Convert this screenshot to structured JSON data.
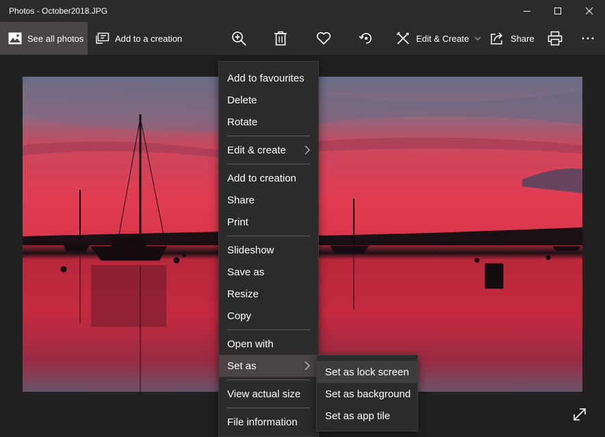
{
  "window": {
    "title": "Photos - October2018.JPG"
  },
  "toolbar": {
    "see_all_photos": "See all photos",
    "add_to_creation": "Add to a creation",
    "edit_create": "Edit & Create",
    "share": "Share",
    "icons": [
      "zoom-in-icon",
      "delete-icon",
      "heart-icon",
      "rotate-icon",
      "edit-create-icon",
      "share-icon",
      "print-icon",
      "more-icon"
    ]
  },
  "context_menu": {
    "add_to_favourites": "Add to favourites",
    "delete": "Delete",
    "rotate": "Rotate",
    "edit_create": "Edit & create",
    "add_to_creation": "Add to creation",
    "share": "Share",
    "print": "Print",
    "slideshow": "Slideshow",
    "save_as": "Save as",
    "resize": "Resize",
    "copy": "Copy",
    "open_with": "Open with",
    "set_as": "Set as",
    "view_actual_size": "View actual size",
    "file_information": "File information"
  },
  "submenu": {
    "lock_screen": "Set as lock screen",
    "background": "Set as background",
    "app_tile": "Set as app tile"
  },
  "colors": {
    "chrome": "#2b2b2b",
    "active": "#4a4444",
    "sky_red": "#d8364a",
    "water_red": "#c42a3e"
  }
}
